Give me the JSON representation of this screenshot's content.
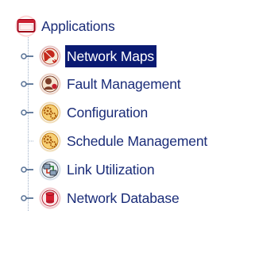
{
  "tree": {
    "root": {
      "label": "Applications",
      "icon": "window-icon"
    },
    "items": [
      {
        "label": "Network Maps",
        "icon": "network-maps-icon",
        "selected": true,
        "has_handle": true
      },
      {
        "label": "Fault Management",
        "icon": "fault-management-icon",
        "selected": false,
        "has_handle": true
      },
      {
        "label": "Configuration",
        "icon": "configuration-icon",
        "selected": false,
        "has_handle": true
      },
      {
        "label": "Schedule Management",
        "icon": "schedule-management-icon",
        "selected": false,
        "has_handle": false
      },
      {
        "label": "Link Utilization",
        "icon": "link-utilization-icon",
        "selected": false,
        "has_handle": true
      },
      {
        "label": "Network Database",
        "icon": "network-database-icon",
        "selected": false,
        "has_handle": true
      }
    ]
  },
  "colors": {
    "label_text": "#1a2c78",
    "selection_bg": "#0a1a72",
    "selection_text": "#ffffff",
    "tree_line": "#9fb0c8"
  }
}
